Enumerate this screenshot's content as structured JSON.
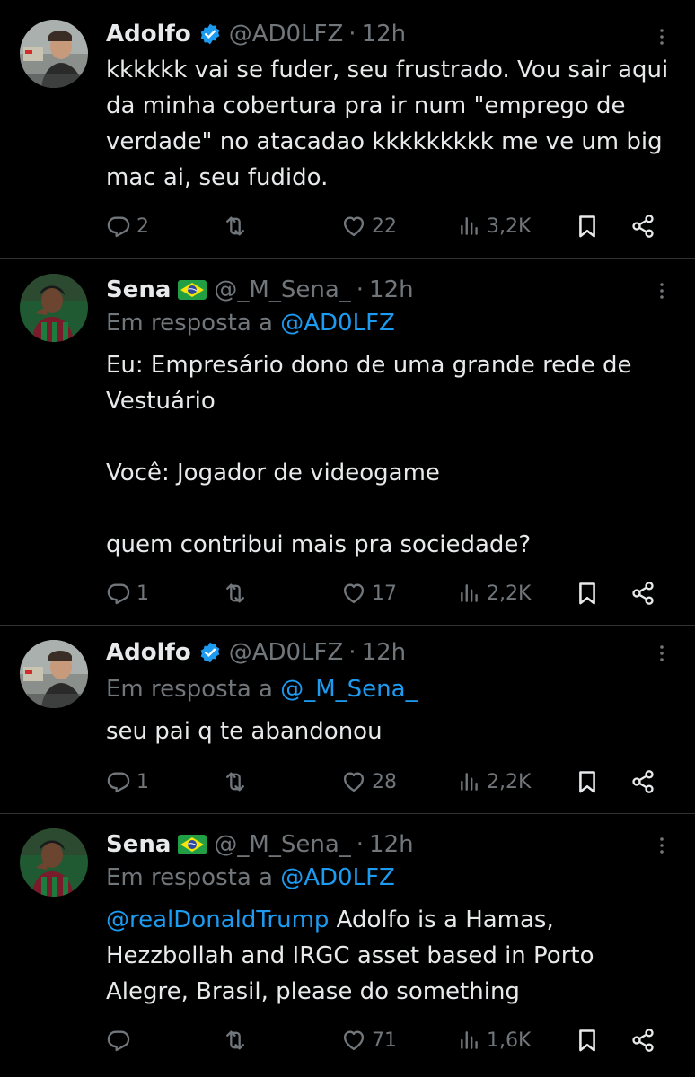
{
  "tweets": [
    {
      "name": "Adolfo",
      "verified": true,
      "handle": "@AD0LFZ",
      "time": "12h",
      "reply_to_label": "",
      "reply_to": "",
      "text": [
        "kkkkkk vai se fuder, seu frustrado. Vou sair aqui da minha cobertura pra ir num \"emprego de verdade\" no atacadao kkkkkkkkk me ve um big mac ai, seu fudido."
      ],
      "replies": "2",
      "retweets": "",
      "likes": "22",
      "views": "3,2K"
    },
    {
      "name": "Sena",
      "flag": "brazil-flag",
      "handle": "@_M_Sena_",
      "time": "12h",
      "reply_to_label": "Em resposta a",
      "reply_to": "@AD0LFZ",
      "text_lines": [
        "Eu: Empresário dono de uma grande rede de",
        "Vestuário",
        "",
        "Você: Jogador de videogame",
        "",
        "quem contribui mais pra sociedade?"
      ],
      "replies": "1",
      "retweets": "",
      "likes": "17",
      "views": "2,2K"
    },
    {
      "name": "Adolfo",
      "verified": true,
      "handle": "@AD0LFZ",
      "time": "12h",
      "reply_to_label": "Em resposta a",
      "reply_to": "@_M_Sena_",
      "text_lines": [
        "seu pai q te abandonou"
      ],
      "replies": "1",
      "retweets": "",
      "likes": "28",
      "views": "2,2K"
    },
    {
      "name": "Sena",
      "flag": "brazil-flag",
      "handle": "@_M_Sena_",
      "time": "12h",
      "reply_to_label": "Em resposta a",
      "reply_to": "@AD0LFZ",
      "mention": "@realDonaldTrump",
      "text_lines": [
        "Adolfo is a Hamas,",
        "Hezzbollah and IRGC asset based in Porto",
        "Alegre, Brasil, please do something"
      ],
      "replies": "",
      "retweets": "",
      "likes": "71",
      "views": "1,6K"
    }
  ],
  "colors": {
    "accent": "#1d9bf0",
    "muted": "#71767b",
    "text": "#e7e9ea",
    "background": "#000000",
    "divider": "#2f3336"
  },
  "icons": [
    "verified-badge-icon",
    "brazil-flag-icon",
    "more-icon",
    "reply-icon",
    "retweet-icon",
    "like-icon",
    "views-icon",
    "bookmark-icon",
    "share-icon"
  ]
}
